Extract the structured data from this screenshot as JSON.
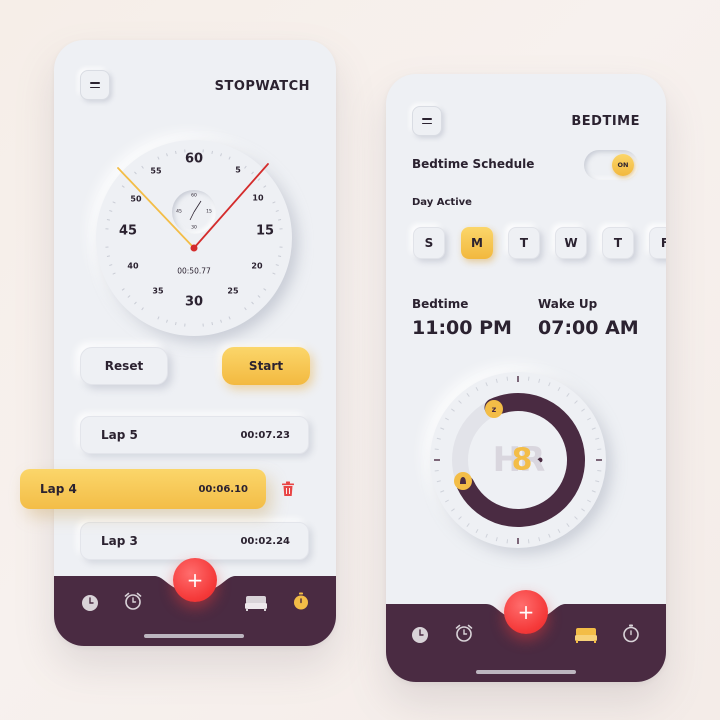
{
  "stopwatch": {
    "title": "STOPWATCH",
    "dial": {
      "big_numbers": [
        "60",
        "15",
        "30",
        "45"
      ],
      "small_numbers": [
        "5",
        "10",
        "20",
        "25",
        "35",
        "40",
        "50",
        "55"
      ],
      "inner_numbers": [
        "60",
        "15",
        "30",
        "45"
      ],
      "time": "00:50.77"
    },
    "reset_label": "Reset",
    "start_label": "Start",
    "laps": [
      {
        "name": "Lap 5",
        "time": "00:07.23"
      },
      {
        "name": "Lap 4",
        "time": "00:06.10"
      },
      {
        "name": "Lap 3",
        "time": "00:02.24"
      }
    ],
    "fab_label": "+"
  },
  "bedtime": {
    "title": "BEDTIME",
    "schedule_label": "Bedtime Schedule",
    "toggle_label": "ON",
    "day_active_label": "Day Active",
    "days": [
      "S",
      "M",
      "T",
      "W",
      "T",
      "F"
    ],
    "selected_day_index": 1,
    "bedtime_label": "Bedtime",
    "bedtime_value": "11:00 PM",
    "wakeup_label": "Wake Up",
    "wakeup_value": "07:00 AM",
    "hours_bg": "HR",
    "hours_value": "8",
    "fab_label": "+"
  },
  "colors": {
    "accent": "#f3bd47",
    "tabbar": "#4a2b42",
    "fab": "#f53a3a",
    "background": "#eef0f4"
  },
  "tab_icons": [
    "clock-icon",
    "alarm-icon",
    "bed-icon",
    "stopwatch-icon"
  ]
}
